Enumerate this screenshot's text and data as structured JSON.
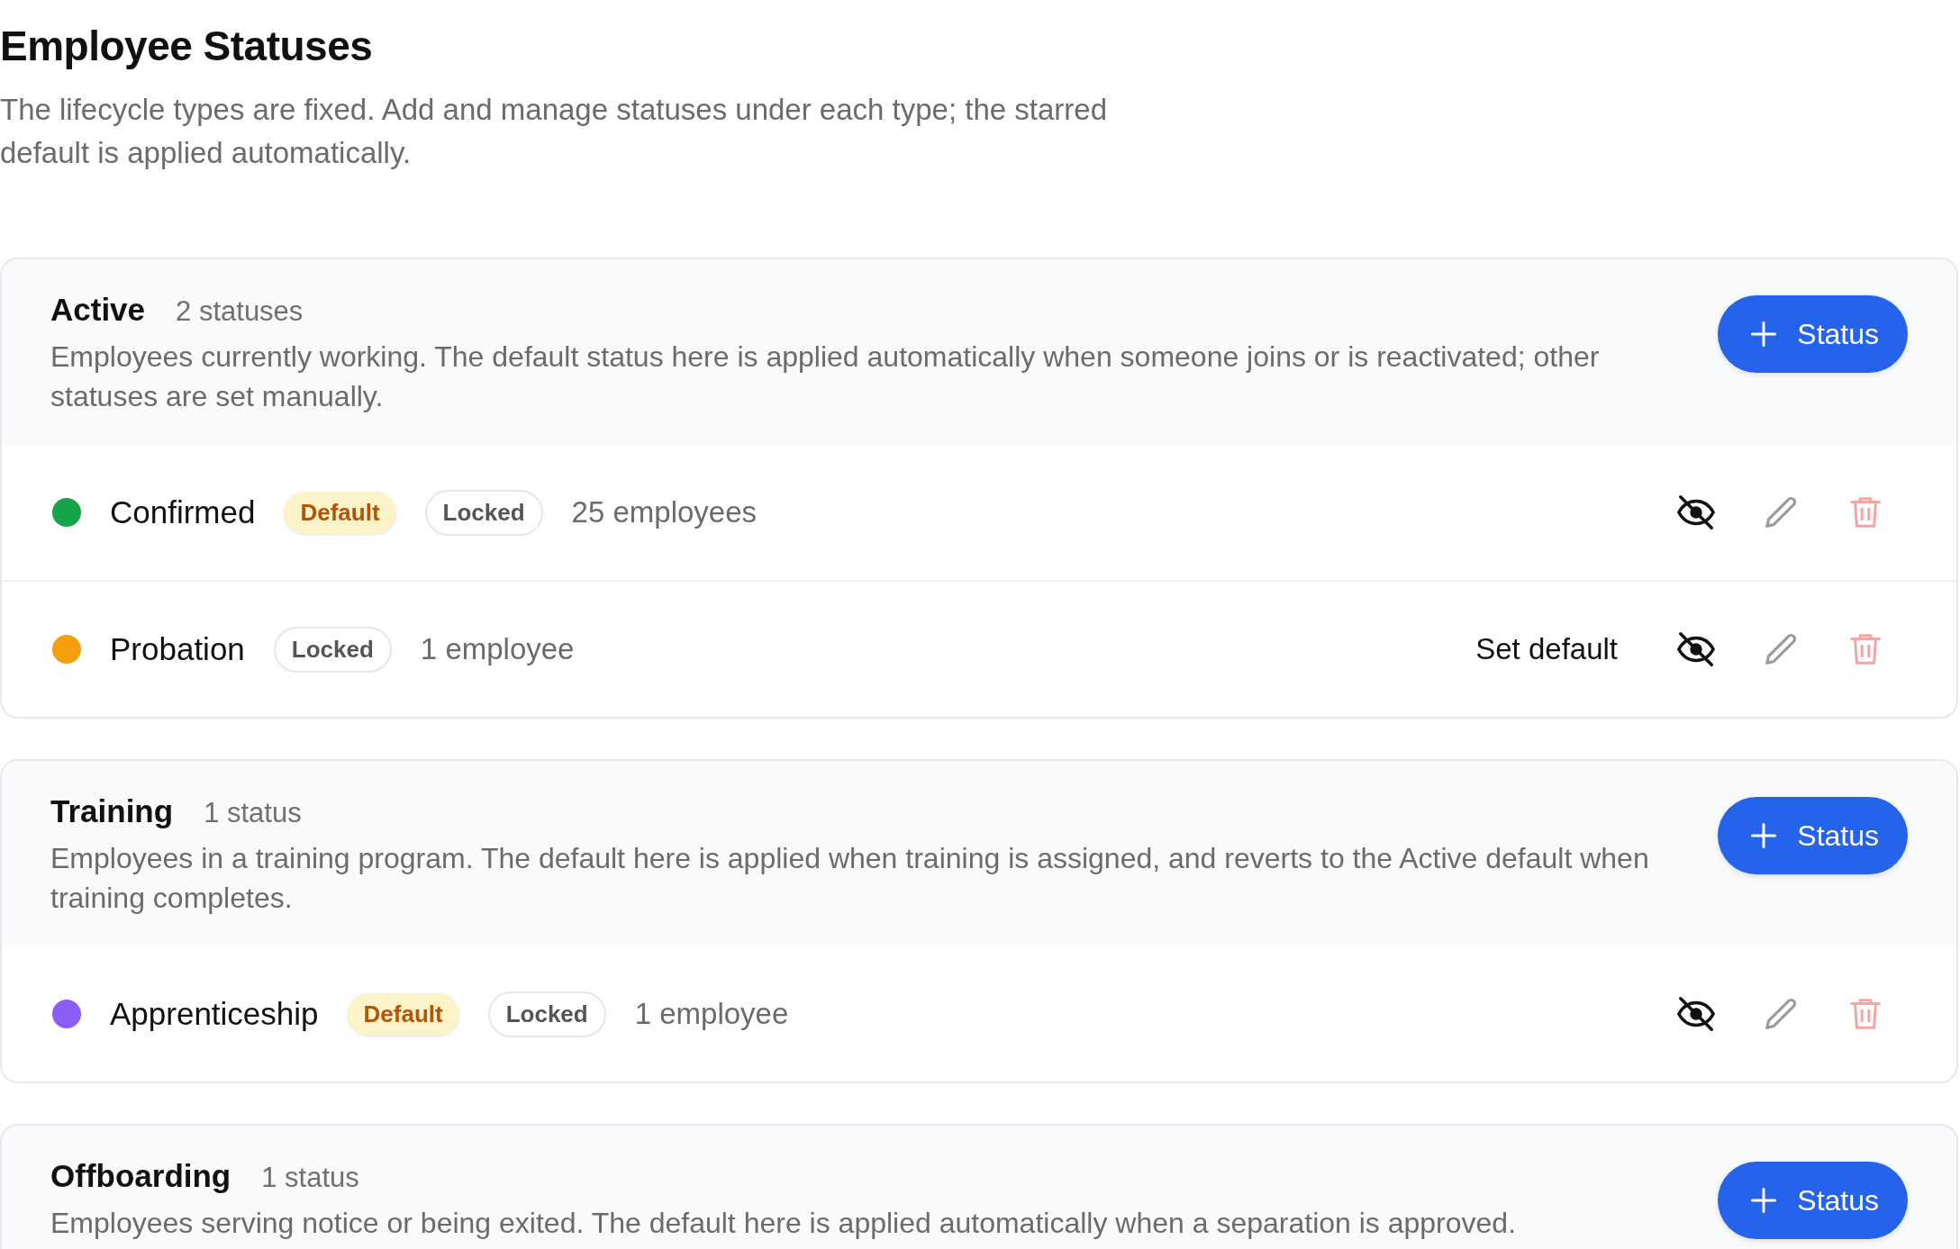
{
  "title": "Employee Statuses",
  "description": "The lifecycle types are fixed. Add and manage statuses under each type; the starred default is applied automatically.",
  "groups": [
    {
      "name": "Active",
      "count": "2 statuses",
      "description": "Employees currently working. The default status here is applied automatically when someone joins or is reactivated; other statuses are set manually.",
      "add_button": "Status",
      "statuses": [
        {
          "name": "Confirmed",
          "color": "#16a34a",
          "badges": [
            {
              "kind": "default",
              "label": "Default"
            },
            {
              "kind": "locked",
              "label": "Locked"
            }
          ],
          "employees": "25 employees"
        },
        {
          "name": "Probation",
          "color": "#f59e0b",
          "badges": [
            {
              "kind": "locked",
              "label": "Locked"
            }
          ],
          "employees": "1 employee",
          "action": "Set default"
        }
      ]
    },
    {
      "name": "Training",
      "count": "1 status",
      "description": "Employees in a training program. The default here is applied when training is assigned, and reverts to the Active default when training completes.",
      "add_button": "Status",
      "statuses": [
        {
          "name": "Apprenticeship",
          "color": "#8b5cf6",
          "badges": [
            {
              "kind": "default",
              "label": "Default"
            },
            {
              "kind": "locked",
              "label": "Locked"
            }
          ],
          "employees": "1 employee"
        }
      ]
    },
    {
      "name": "Offboarding",
      "count": "1 status",
      "description": "Employees serving notice or being exited. The default here is applied automatically when a separation is approved.",
      "add_button": "Status"
    }
  ]
}
